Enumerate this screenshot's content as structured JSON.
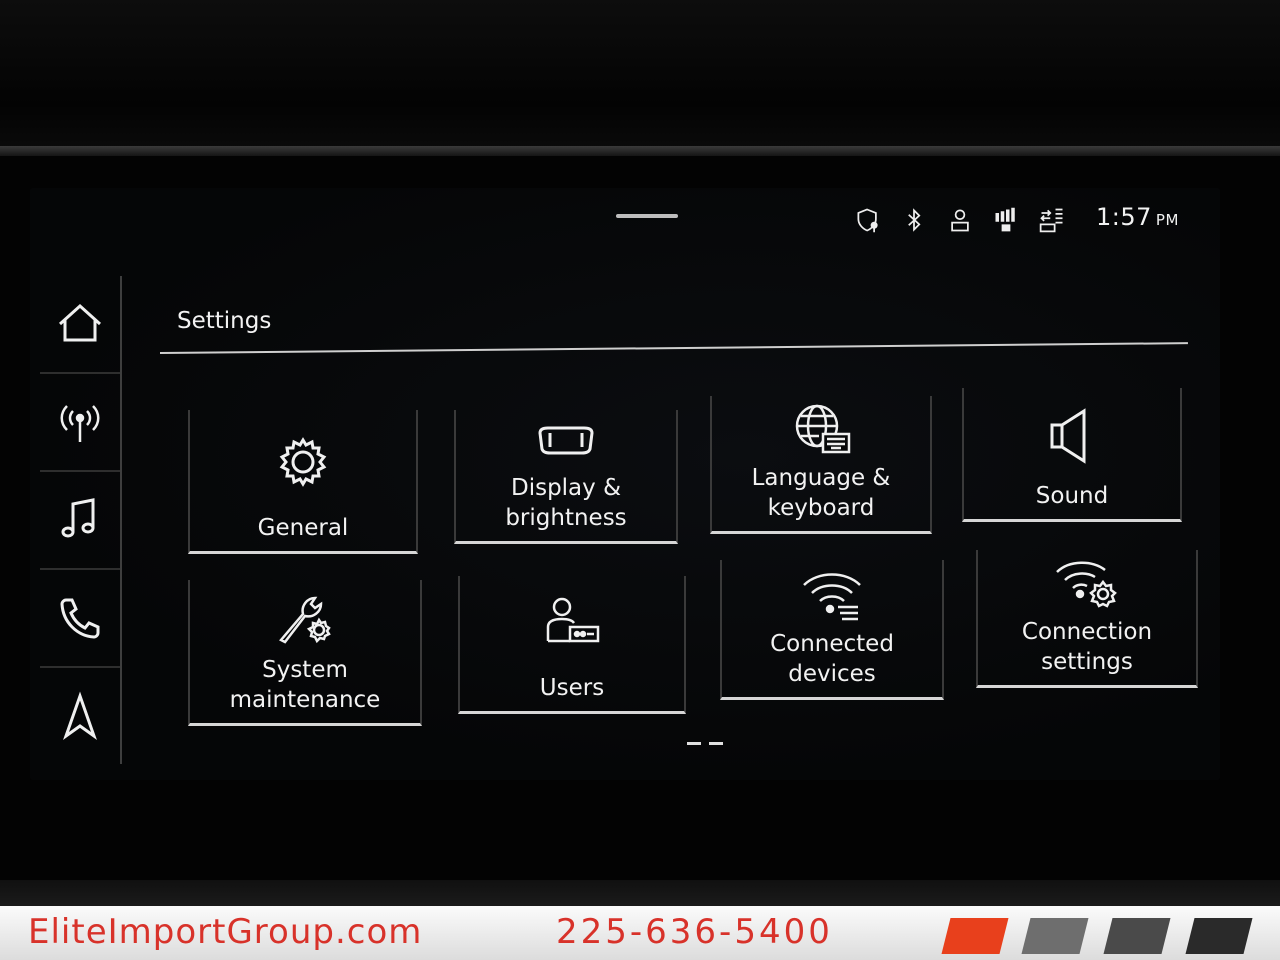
{
  "status_bar": {
    "time": "1:57",
    "ampm": "PM",
    "icons": [
      "privacy-location-icon",
      "bluetooth-icon",
      "user-icon",
      "signal-3g-icon",
      "lte-icon"
    ]
  },
  "rail": {
    "items": [
      "home-icon",
      "radio-icon",
      "music-icon",
      "phone-icon",
      "navigation-icon"
    ]
  },
  "page": {
    "title": "Settings"
  },
  "tiles": [
    {
      "label": "General",
      "icon": "gear-icon"
    },
    {
      "label": "Display &\nbrightness",
      "icon": "display-icon"
    },
    {
      "label": "Language &\nkeyboard",
      "icon": "globe-keyboard-icon"
    },
    {
      "label": "Sound",
      "icon": "speaker-icon"
    },
    {
      "label": "System\nmaintenance",
      "icon": "wrench-gear-icon"
    },
    {
      "label": "Users",
      "icon": "user-card-icon"
    },
    {
      "label": "Connected\ndevices",
      "icon": "wifi-devices-icon"
    },
    {
      "label": "Connection\nsettings",
      "icon": "wifi-gear-icon"
    }
  ],
  "banner": {
    "site": "EliteImportGroup.com",
    "phone": "225-636-5400",
    "colors": {
      "red": "#d8322a",
      "stripe_red": "#e8401c",
      "stripe_gray": "#6e6e6e",
      "stripe_dark": "#3a3a3a"
    }
  }
}
